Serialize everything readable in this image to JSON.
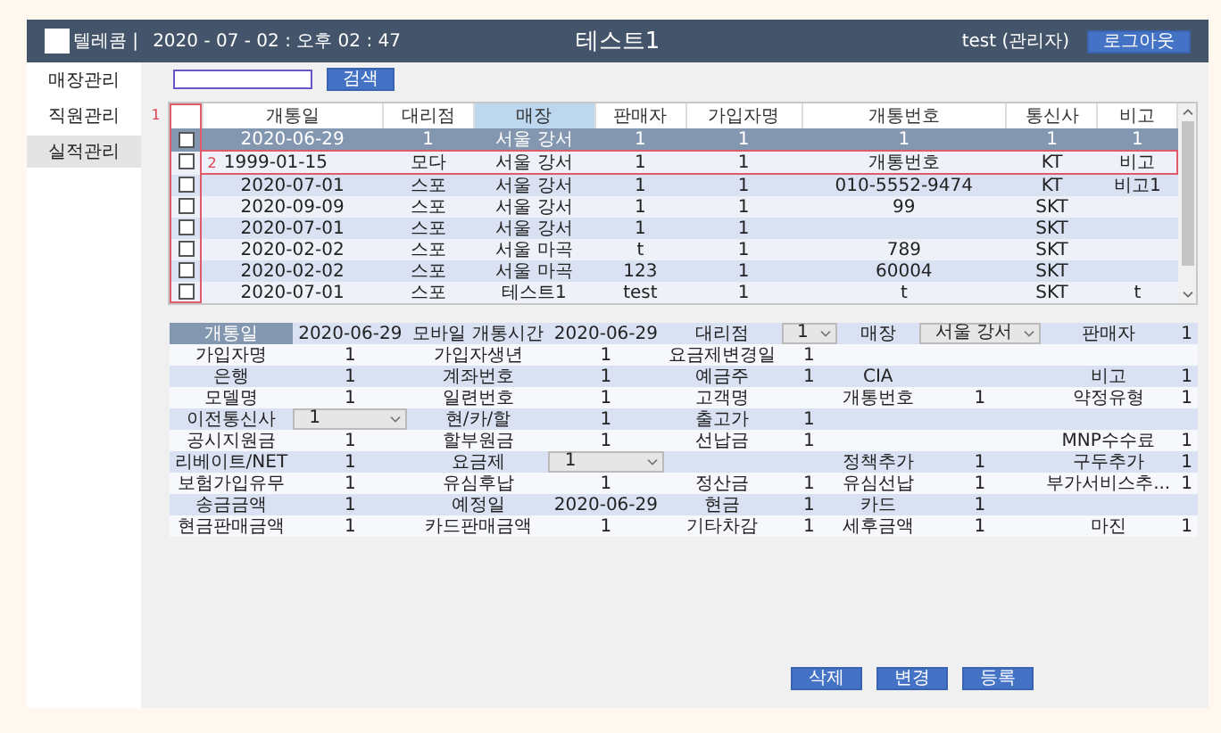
{
  "header": {
    "brand": "텔레콤 |",
    "datetime": "2020 - 07 - 02 : 오후 02 : 47",
    "title": "테스트1",
    "user": "test (관리자)",
    "logout": "로그아웃"
  },
  "sidebar": {
    "items": [
      {
        "label": "매장관리",
        "selected": false
      },
      {
        "label": "직원관리",
        "selected": false
      },
      {
        "label": "실적관리",
        "selected": true
      }
    ]
  },
  "search": {
    "button": "검색"
  },
  "table": {
    "column_marker": "1",
    "columns": [
      {
        "label": "개통일",
        "selected": false
      },
      {
        "label": "대리점",
        "selected": false
      },
      {
        "label": "매장",
        "selected": true
      },
      {
        "label": "판매자",
        "selected": false
      },
      {
        "label": "가입자명",
        "selected": false
      },
      {
        "label": "개통번호",
        "selected": false
      },
      {
        "label": "통신사",
        "selected": false
      },
      {
        "label": "비고",
        "selected": false
      }
    ],
    "rows": [
      {
        "checked": false,
        "selected": true,
        "cells": [
          "2020-06-29",
          "1",
          "서울 강서",
          "1",
          "1",
          "1",
          "1",
          "1"
        ]
      },
      {
        "checked": false,
        "selected": false,
        "marker": "2",
        "cells": [
          "1999-01-15",
          "모다",
          "서울 강서",
          "1",
          "1",
          "개통번호",
          "KT",
          "비고"
        ]
      },
      {
        "checked": false,
        "selected": false,
        "cells": [
          "2020-07-01",
          "스포",
          "서울 강서",
          "1",
          "1",
          "010-5552-9474",
          "KT",
          "비고1"
        ]
      },
      {
        "checked": false,
        "selected": false,
        "cells": [
          "2020-09-09",
          "스포",
          "서울 강서",
          "1",
          "1",
          "99",
          "SKT",
          ""
        ]
      },
      {
        "checked": false,
        "selected": false,
        "cells": [
          "2020-07-01",
          "스포",
          "서울 강서",
          "1",
          "1",
          "",
          "SKT",
          ""
        ]
      },
      {
        "checked": false,
        "selected": false,
        "cells": [
          "2020-02-02",
          "스포",
          "서울 마곡",
          "t",
          "1",
          "789",
          "SKT",
          ""
        ]
      },
      {
        "checked": false,
        "selected": false,
        "cells": [
          "2020-02-02",
          "스포",
          "서울 마곡",
          "123",
          "1",
          "60004",
          "SKT",
          ""
        ]
      },
      {
        "checked": false,
        "selected": false,
        "cells": [
          "2020-07-01",
          "스포",
          "테스트1",
          "test",
          "1",
          "t",
          "SKT",
          "t"
        ]
      }
    ]
  },
  "details": {
    "rows": [
      [
        {
          "kind": "label",
          "text": "개통일",
          "selected": true
        },
        {
          "kind": "value",
          "text": "2020-06-29"
        },
        {
          "kind": "label",
          "text": "모바일 개통시간",
          "selected": false
        },
        {
          "kind": "value",
          "text": "2020-06-29"
        },
        {
          "kind": "label",
          "text": "대리점",
          "selected": false
        },
        {
          "kind": "select",
          "text": "1"
        },
        {
          "kind": "label",
          "text": "매장",
          "selected": false
        },
        {
          "kind": "select",
          "text": "서울 강서"
        },
        {
          "kind": "label",
          "text": "판매자",
          "selected": false
        },
        {
          "kind": "value",
          "text": "1"
        }
      ],
      [
        {
          "kind": "label",
          "text": "가입자명",
          "selected": false
        },
        {
          "kind": "value",
          "text": "1"
        },
        {
          "kind": "label",
          "text": "가입자생년",
          "selected": false
        },
        {
          "kind": "value",
          "text": "1"
        },
        {
          "kind": "label",
          "text": "요금제변경일",
          "selected": false
        },
        {
          "kind": "value",
          "text": "1"
        },
        {
          "kind": "empty"
        },
        {
          "kind": "empty"
        },
        {
          "kind": "empty"
        },
        {
          "kind": "empty"
        }
      ],
      [
        {
          "kind": "label",
          "text": "은행",
          "selected": false
        },
        {
          "kind": "value",
          "text": "1"
        },
        {
          "kind": "label",
          "text": "계좌번호",
          "selected": false
        },
        {
          "kind": "value",
          "text": "1"
        },
        {
          "kind": "label",
          "text": "예금주",
          "selected": false
        },
        {
          "kind": "value",
          "text": "1"
        },
        {
          "kind": "label",
          "text": "CIA",
          "selected": false
        },
        {
          "kind": "empty"
        },
        {
          "kind": "label",
          "text": "비고",
          "selected": false
        },
        {
          "kind": "value",
          "text": "1"
        }
      ],
      [
        {
          "kind": "label",
          "text": "모델명",
          "selected": false
        },
        {
          "kind": "value",
          "text": "1"
        },
        {
          "kind": "label",
          "text": "일련번호",
          "selected": false
        },
        {
          "kind": "value",
          "text": "1"
        },
        {
          "kind": "label",
          "text": "고객명",
          "selected": false
        },
        {
          "kind": "empty"
        },
        {
          "kind": "label",
          "text": "개통번호",
          "selected": false
        },
        {
          "kind": "value",
          "text": "1"
        },
        {
          "kind": "label",
          "text": "약정유형",
          "selected": false
        },
        {
          "kind": "value",
          "text": "1"
        }
      ],
      [
        {
          "kind": "label",
          "text": "이전통신사",
          "selected": false
        },
        {
          "kind": "select",
          "text": "1"
        },
        {
          "kind": "label",
          "text": "현/카/할",
          "selected": false
        },
        {
          "kind": "value",
          "text": "1"
        },
        {
          "kind": "label",
          "text": "출고가",
          "selected": false
        },
        {
          "kind": "value",
          "text": "1"
        },
        {
          "kind": "empty"
        },
        {
          "kind": "empty"
        },
        {
          "kind": "empty"
        },
        {
          "kind": "empty"
        }
      ],
      [
        {
          "kind": "label",
          "text": "공시지원금",
          "selected": false
        },
        {
          "kind": "value",
          "text": "1"
        },
        {
          "kind": "label",
          "text": "할부원금",
          "selected": false
        },
        {
          "kind": "value",
          "text": "1"
        },
        {
          "kind": "label",
          "text": "선납금",
          "selected": false
        },
        {
          "kind": "value",
          "text": "1"
        },
        {
          "kind": "empty"
        },
        {
          "kind": "empty"
        },
        {
          "kind": "label",
          "text": "MNP수수료",
          "selected": false
        },
        {
          "kind": "value",
          "text": "1"
        }
      ],
      [
        {
          "kind": "label",
          "text": "리베이트/NET",
          "selected": false
        },
        {
          "kind": "value",
          "text": "1"
        },
        {
          "kind": "label",
          "text": "요금제",
          "selected": false
        },
        {
          "kind": "select",
          "text": "1"
        },
        {
          "kind": "empty"
        },
        {
          "kind": "empty"
        },
        {
          "kind": "label",
          "text": "정책추가",
          "selected": false
        },
        {
          "kind": "value",
          "text": "1"
        },
        {
          "kind": "label",
          "text": "구두추가",
          "selected": false
        },
        {
          "kind": "value",
          "text": "1"
        }
      ],
      [
        {
          "kind": "label",
          "text": "보험가입유무",
          "selected": false
        },
        {
          "kind": "value",
          "text": "1"
        },
        {
          "kind": "label",
          "text": "유심후납",
          "selected": false
        },
        {
          "kind": "value",
          "text": "1"
        },
        {
          "kind": "label",
          "text": "정산금",
          "selected": false
        },
        {
          "kind": "value",
          "text": "1"
        },
        {
          "kind": "label",
          "text": "유심선납",
          "selected": false
        },
        {
          "kind": "value",
          "text": "1"
        },
        {
          "kind": "label",
          "text": "부가서비스추...",
          "selected": false
        },
        {
          "kind": "value",
          "text": "1"
        }
      ],
      [
        {
          "kind": "label",
          "text": "송금금액",
          "selected": false
        },
        {
          "kind": "value",
          "text": "1"
        },
        {
          "kind": "label",
          "text": "예정일",
          "selected": false
        },
        {
          "kind": "value",
          "text": "2020-06-29"
        },
        {
          "kind": "label",
          "text": "현금",
          "selected": false
        },
        {
          "kind": "value",
          "text": "1"
        },
        {
          "kind": "label",
          "text": "카드",
          "selected": false
        },
        {
          "kind": "value",
          "text": "1"
        },
        {
          "kind": "empty"
        },
        {
          "kind": "empty"
        }
      ],
      [
        {
          "kind": "label",
          "text": "현금판매금액",
          "selected": false
        },
        {
          "kind": "value",
          "text": "1"
        },
        {
          "kind": "label",
          "text": "카드판매금액",
          "selected": false
        },
        {
          "kind": "value",
          "text": "1"
        },
        {
          "kind": "label",
          "text": "기타차감",
          "selected": false
        },
        {
          "kind": "value",
          "text": "1"
        },
        {
          "kind": "label",
          "text": "세후금액",
          "selected": false
        },
        {
          "kind": "value",
          "text": "1"
        },
        {
          "kind": "label",
          "text": "마진",
          "selected": false
        },
        {
          "kind": "value",
          "text": "1"
        }
      ]
    ]
  },
  "buttons": [
    "삭제",
    "변경",
    "등록"
  ]
}
